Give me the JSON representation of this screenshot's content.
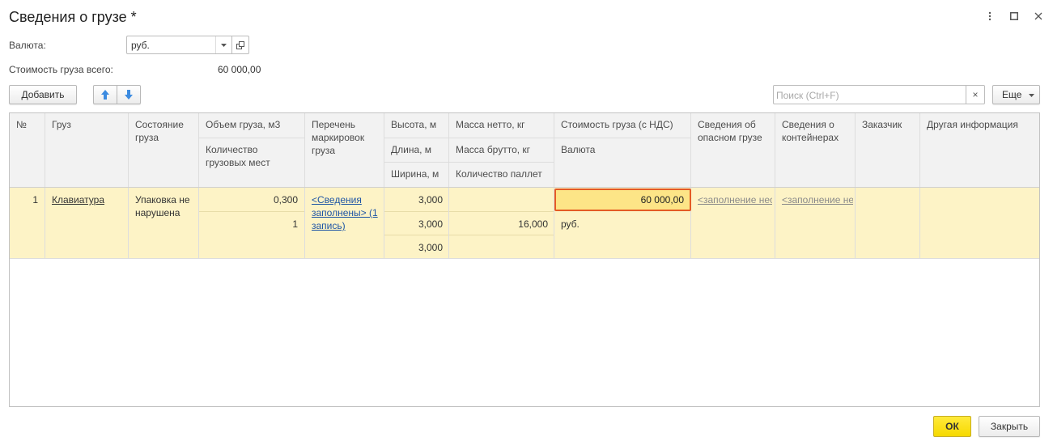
{
  "window": {
    "title": "Сведения о грузе *"
  },
  "form": {
    "currency_label": "Валюта:",
    "currency_value": "руб.",
    "total_label": "Стоимость груза всего:",
    "total_value": "60 000,00"
  },
  "toolbar": {
    "add_label": "Добавить",
    "search_placeholder": "Поиск (Ctrl+F)",
    "clear_label": "×",
    "more_label": "Еще"
  },
  "table": {
    "headers": {
      "num": "№",
      "cargo": "Груз",
      "state": "Состояние груза",
      "volume": "Объем груза, м3",
      "places": "Количество грузовых мест",
      "markings": "Перечень маркировок груза",
      "height": "Высота, м",
      "length": "Длина, м",
      "width": "Ширина, м",
      "net_mass": "Масса нетто, кг",
      "gross_mass": "Масса брутто, кг",
      "pallets": "Количество паллет",
      "cost": "Стоимость груза (с НДС)",
      "currency": "Валюта",
      "dangerous": "Сведения об опасном грузе",
      "containers": "Сведения о контейнерах",
      "customer": "Заказчик",
      "other": "Другая информация"
    },
    "rows": [
      {
        "num": "1",
        "cargo": "Клавиатура",
        "state": "Упаковка не нарушена",
        "volume": "0,300",
        "places": "1",
        "markings": "<Сведения заполнены> (1 запись)",
        "height": "3,000",
        "length": "3,000",
        "width": "3,000",
        "net_mass": "",
        "gross_mass": "16,000",
        "pallets": "",
        "cost": "60 000,00",
        "currency": "руб.",
        "dangerous": "<заполнение необязательн",
        "containers": "<заполнение необязательн",
        "customer": "",
        "other": ""
      }
    ]
  },
  "footer": {
    "ok_label": "ОК",
    "close_label": "Закрыть"
  },
  "icons": {
    "menu": "more-vertical-icon",
    "maximize": "maximize-icon",
    "close": "close-icon",
    "dropdown": "dropdown-arrow-icon",
    "open": "open-external-icon",
    "up": "arrow-up-icon",
    "down": "arrow-down-icon"
  },
  "colors": {
    "row_highlight": "#fdf3c6",
    "focus_cell": "#fde587",
    "focus_border": "#e45b25",
    "ok_button": "#f6d900",
    "arrow_blue": "#3c8be0",
    "link_blue": "#1f55a5"
  }
}
